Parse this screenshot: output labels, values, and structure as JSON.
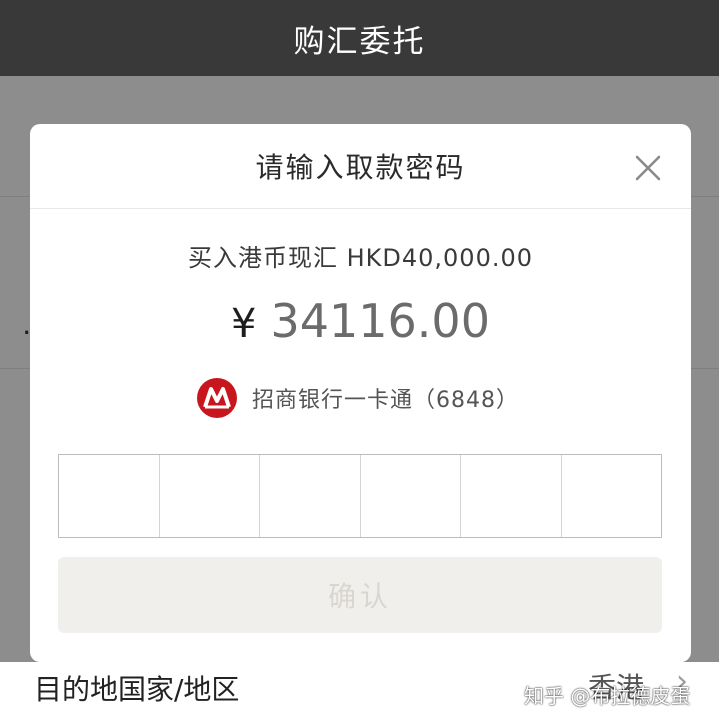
{
  "header": {
    "title": "购汇委托"
  },
  "background": {
    "left_glyph": "…",
    "destination_label": "目的地国家/地区",
    "destination_value": "香港"
  },
  "dialog": {
    "title": "请输入取款密码",
    "purchase_text": "买入港币现汇 HKD40,000.00",
    "currency_symbol": "¥",
    "amount": "34116.00",
    "card_label": "招商银行一卡通（6848）",
    "confirm_label": "确认"
  },
  "watermark": "知乎 @布拉德皮蛋",
  "colors": {
    "header_bg": "#393939",
    "overlay": "#8d8d8d",
    "bank_logo": "#c8161e",
    "confirm_disabled_bg": "#f1efec"
  },
  "icons": {
    "close": "close-icon",
    "bank": "cmb-logo-icon",
    "arrow": "chevron-right-icon"
  }
}
